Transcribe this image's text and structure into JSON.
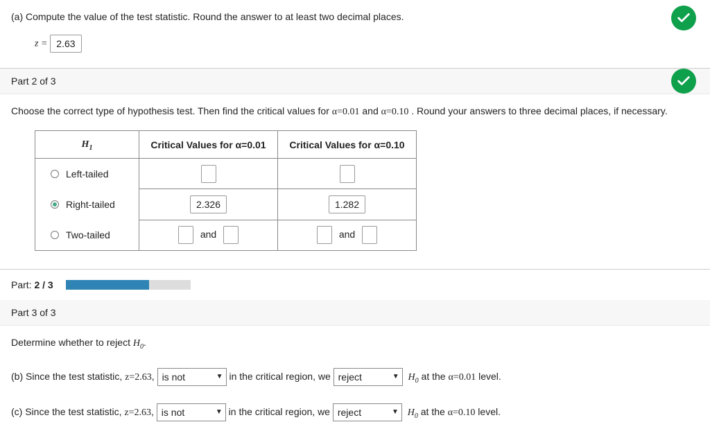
{
  "partA": {
    "prompt": "(a) Compute the value of the test statistic. Round the answer to at least two decimal places.",
    "z_label": "z =",
    "z_value": "2.63"
  },
  "part2": {
    "header": "Part 2 of 3",
    "prompt_pre": "Choose the correct type of hypothesis test. Then find the critical values for ",
    "alpha1": "α=0.01",
    "and": " and ",
    "alpha2": "α=0.10",
    "prompt_post": ". Round your answers to three decimal places, if necessary.",
    "table": {
      "h1": "H",
      "h1_sub": "1",
      "col1": "Critical Values for α=0.01",
      "col2": "Critical Values for α=0.10",
      "rows": [
        {
          "label": "Left-tailed",
          "checked": false,
          "v1": "",
          "v2": ""
        },
        {
          "label": "Right-tailed",
          "checked": true,
          "v1": "2.326",
          "v2": "1.282"
        },
        {
          "label": "Two-tailed",
          "checked": false,
          "v1a": "",
          "v1b": "",
          "v2a": "",
          "v2b": "",
          "and": "and"
        }
      ]
    }
  },
  "progress": {
    "label": "Part: 2 / 3",
    "pct": 66.6
  },
  "part3": {
    "header": "Part 3 of 3",
    "prompt_pre": "Determine whether to reject ",
    "H0": "H",
    "H0_sub": "0",
    "dot": ".",
    "b": {
      "pre": "(b) Since the test statistic, ",
      "z": "z=2.63",
      "comma": ", ",
      "sel1": "is not",
      "mid": " in the critical region, we ",
      "sel2": "reject",
      "post_pre": " at the ",
      "alpha": "α=0.01",
      "post": " level."
    },
    "c": {
      "pre": "(c) Since the test statistic, ",
      "z": "z=2.63",
      "comma": ", ",
      "sel1": "is not",
      "mid": " in the critical region, we ",
      "sel2": "reject",
      "post_pre": " at the ",
      "alpha": "α=0.10",
      "post": " level."
    }
  }
}
